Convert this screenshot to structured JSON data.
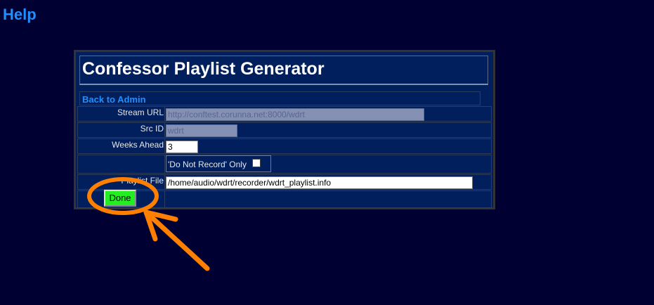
{
  "help_link": "Help",
  "title": "Confessor Playlist Generator",
  "back_link": "Back to Admin",
  "fields": {
    "stream_url": {
      "label": "Stream URL",
      "value": "http://conftest.corunna.net:8000/wdrt"
    },
    "src_id": {
      "label": "Src ID",
      "value": "wdrt"
    },
    "weeks_ahead": {
      "label": "Weeks Ahead",
      "value": "3"
    },
    "do_not_record": {
      "label": "'Do Not Record' Only",
      "checked": false
    },
    "playlist_file": {
      "label": "Playlist File",
      "value": "/home/audio/wdrt/recorder/wdrt_playlist.info"
    }
  },
  "done_button": "Done",
  "annotation": {
    "color": "#ff7f00"
  }
}
